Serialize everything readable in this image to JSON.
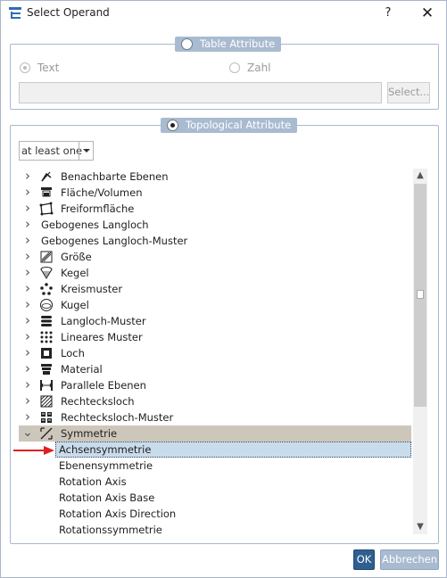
{
  "window": {
    "title": "Select Operand",
    "help_label": "?",
    "close_label": "✕"
  },
  "table_attribute": {
    "legend": "Table Attribute",
    "selected": false,
    "radio_text": "Text",
    "radio_zahl": "Zahl",
    "value": "",
    "select_button": "Select..."
  },
  "topological_attribute": {
    "legend": "Topological Attribute",
    "selected": true,
    "combo_value": "at least one"
  },
  "tree": {
    "items": [
      {
        "label": "Benachbarte Ebenen",
        "icon": "adjacent-planes-icon",
        "expanded": false
      },
      {
        "label": "Fläche/Volumen",
        "icon": "area-volume-icon",
        "expanded": false
      },
      {
        "label": "Freiformfläche",
        "icon": "freeform-surface-icon",
        "expanded": false
      },
      {
        "label": "Gebogenes Langloch",
        "icon": "",
        "expanded": false
      },
      {
        "label": "Gebogenes Langloch-Muster",
        "icon": "",
        "expanded": false
      },
      {
        "label": "Größe",
        "icon": "size-icon",
        "expanded": false
      },
      {
        "label": "Kegel",
        "icon": "cone-icon",
        "expanded": false
      },
      {
        "label": "Kreismuster",
        "icon": "circular-pattern-icon",
        "expanded": false
      },
      {
        "label": "Kugel",
        "icon": "sphere-icon",
        "expanded": false
      },
      {
        "label": "Langloch-Muster",
        "icon": "slot-pattern-icon",
        "expanded": false
      },
      {
        "label": "Lineares Muster",
        "icon": "linear-pattern-icon",
        "expanded": false
      },
      {
        "label": "Loch",
        "icon": "hole-icon",
        "expanded": false
      },
      {
        "label": "Material",
        "icon": "material-icon",
        "expanded": false
      },
      {
        "label": "Parallele Ebenen",
        "icon": "parallel-planes-icon",
        "expanded": false
      },
      {
        "label": "Rechtecksloch",
        "icon": "rectangular-hole-icon",
        "expanded": false
      },
      {
        "label": "Rechtecksloch-Muster",
        "icon": "rectangular-hole-pattern-icon",
        "expanded": false
      },
      {
        "label": "Symmetrie",
        "icon": "symmetry-icon",
        "expanded": true
      }
    ],
    "children": [
      {
        "label": "Achsensymmetrie",
        "selected": true
      },
      {
        "label": "Ebenensymmetrie",
        "selected": false
      },
      {
        "label": "Rotation Axis",
        "selected": false
      },
      {
        "label": "Rotation Axis Base",
        "selected": false
      },
      {
        "label": "Rotation Axis Direction",
        "selected": false
      },
      {
        "label": "Rotationssymmetrie",
        "selected": false
      }
    ]
  },
  "buttons": {
    "ok": "OK",
    "cancel": "Abbrechen"
  },
  "colors": {
    "accent": "#2f5f8f",
    "legend_bg": "#a9bbd0",
    "selection": "#c9dcec",
    "arrow": "#e02020"
  }
}
